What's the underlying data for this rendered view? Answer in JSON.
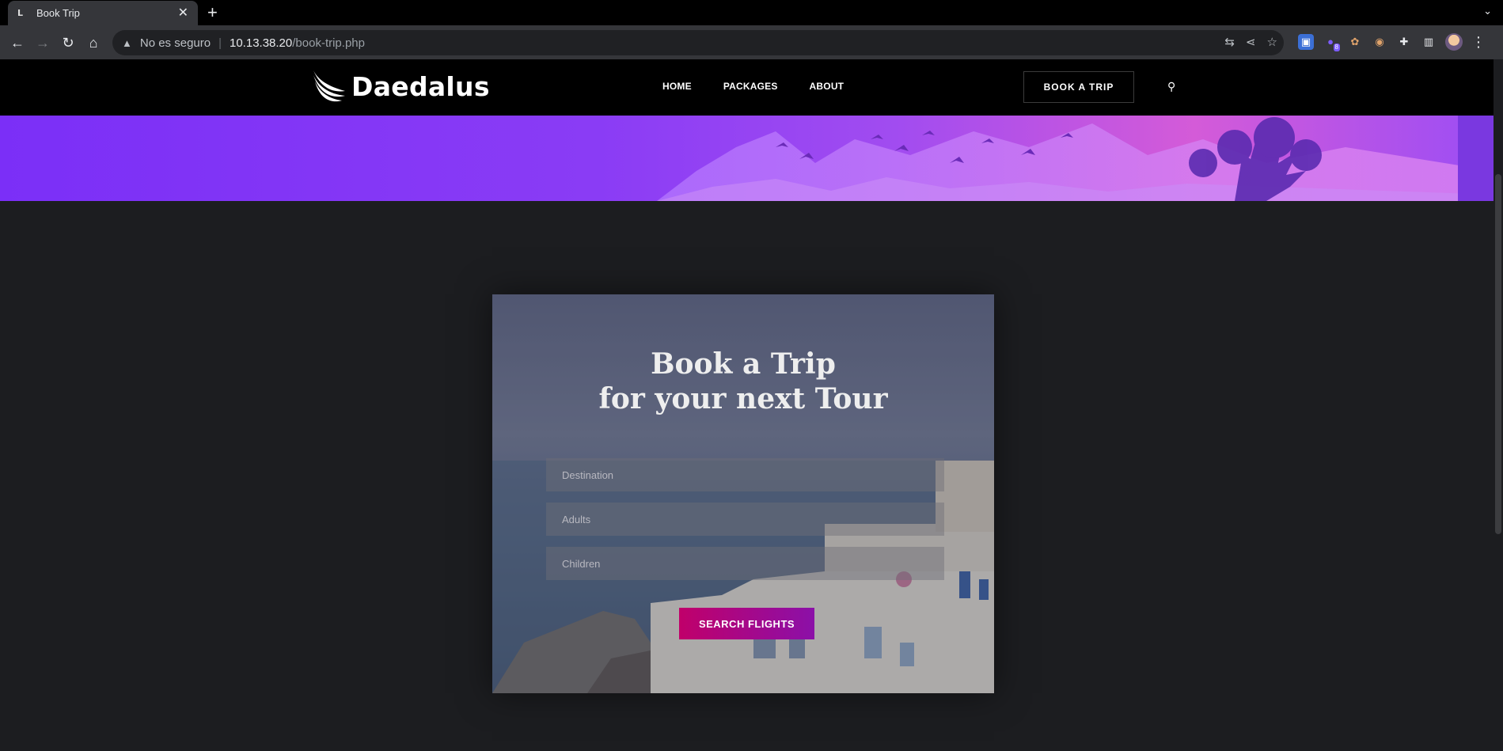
{
  "browser": {
    "tab_title": "Book Trip",
    "tab_favicon": "L",
    "url_warning": "No es seguro",
    "url_host": "10.13.38.20",
    "url_path": "/book-trip.php",
    "extension_badge": "8"
  },
  "site": {
    "logo_text": "Daedalus",
    "nav": [
      "HOME",
      "PACKAGES",
      "ABOUT"
    ],
    "book_button": "BOOK A TRIP",
    "colors": {
      "accent_start": "#c0006a",
      "accent_end": "#8b10a8",
      "hero": "#8a3cf5"
    }
  },
  "booking": {
    "title_line1": "Book a Trip",
    "title_line2": "for your next Tour",
    "destination_placeholder": "Destination",
    "adults_placeholder": "Adults",
    "children_placeholder": "Children",
    "submit_label": "SEARCH FLIGHTS"
  }
}
